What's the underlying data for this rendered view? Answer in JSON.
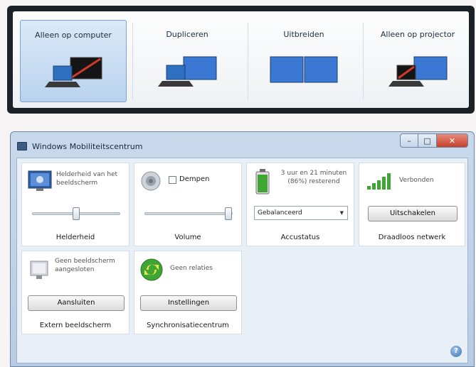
{
  "projector_switcher": {
    "options": [
      {
        "label": "Alleen op computer",
        "selected": true
      },
      {
        "label": "Dupliceren",
        "selected": false
      },
      {
        "label": "Uitbreiden",
        "selected": false
      },
      {
        "label": "Alleen op projector",
        "selected": false
      }
    ]
  },
  "window": {
    "title": "Windows Mobiliteitscentrum",
    "controls": {
      "minimize": "–",
      "maximize": "□",
      "close": "✕"
    }
  },
  "tiles": {
    "brightness": {
      "desc": "Helderheid van het beeldscherm",
      "name": "Helderheid",
      "level": 0.5,
      "icon": "display-brightness-icon"
    },
    "volume": {
      "mute_label": "Dempen",
      "muted": false,
      "name": "Volume",
      "level": 0.95,
      "icon": "speaker-icon"
    },
    "battery": {
      "status": "3 uur en 21 minuten (86%) resterend",
      "plan": "Gebalanceerd",
      "name": "Accustatus",
      "charge_percent": 86,
      "icon": "battery-icon"
    },
    "wireless": {
      "status": "Verbonden",
      "button": "Uitschakelen",
      "name": "Draadloos netwerk",
      "icon": "signal-bars-icon"
    },
    "external_display": {
      "status": "Geen beeldscherm aangesloten",
      "button": "Aansluiten",
      "name": "Extern beeldscherm",
      "icon": "monitor-icon"
    },
    "sync": {
      "status": "Geen relaties",
      "button": "Instellingen",
      "name": "Synchronisatiecentrum",
      "icon": "sync-icon"
    }
  },
  "colors": {
    "accent": "#3d72b0",
    "battery_green": "#3fa535",
    "selection": "#b9d2ee"
  }
}
